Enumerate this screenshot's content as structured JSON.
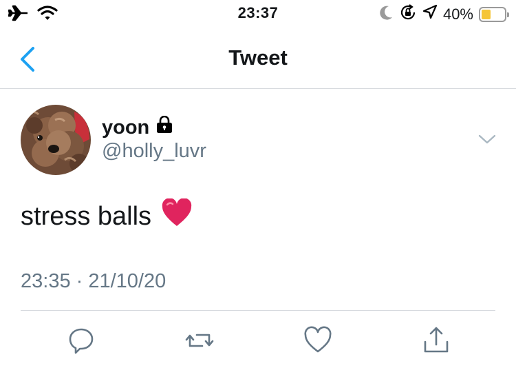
{
  "status_bar": {
    "time": "23:37",
    "battery_percent_text": "40%",
    "battery_level": 0.4,
    "icons": [
      "airplane-icon",
      "wifi-icon",
      "moon-icon",
      "orientation-lock-icon",
      "location-icon",
      "battery-icon"
    ]
  },
  "nav": {
    "title": "Tweet",
    "back_icon": "back-chevron-icon"
  },
  "tweet": {
    "display_name": "yoon",
    "handle": "@holly_luvr",
    "protected_icon": "lock-icon",
    "text": "stress balls",
    "emoji": "❤️",
    "timestamp": "23:35 · 21/10/20"
  },
  "actions": [
    "reply-icon",
    "retweet-icon",
    "like-icon",
    "share-icon"
  ],
  "colors": {
    "accent": "#1da1f2",
    "secondary_text": "#657786",
    "divider": "#d7dadf",
    "battery_fill": "#f5c536",
    "heart": "#e0245e"
  }
}
